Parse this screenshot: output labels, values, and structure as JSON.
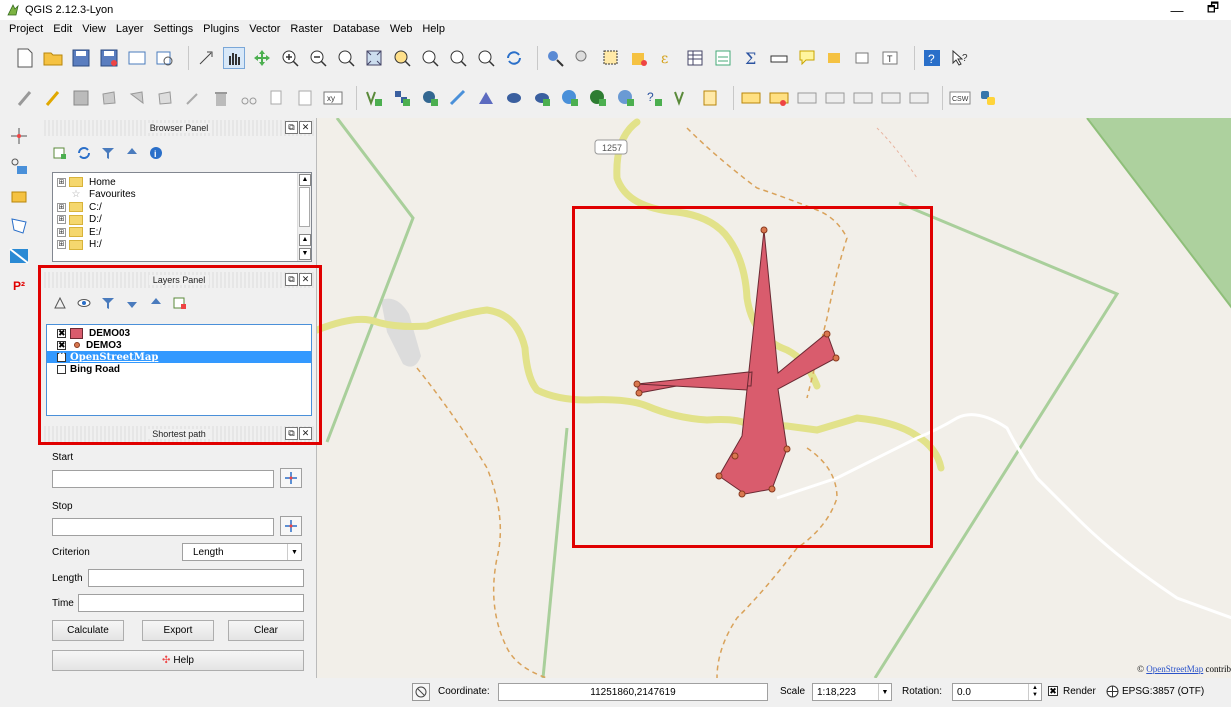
{
  "window": {
    "title": "QGIS 2.12.3-Lyon",
    "minimize": "—",
    "restore": "🗗"
  },
  "menu": [
    "Project",
    "Edit",
    "View",
    "Layer",
    "Settings",
    "Plugins",
    "Vector",
    "Raster",
    "Database",
    "Web",
    "Help"
  ],
  "browser_panel": {
    "title": "Browser Panel",
    "items": [
      {
        "label": "Home",
        "type": "folder",
        "expand": "⊞"
      },
      {
        "label": "Favourites",
        "type": "star",
        "expand": ""
      },
      {
        "label": "C:/",
        "type": "folder",
        "expand": "⊞"
      },
      {
        "label": "D:/",
        "type": "folder",
        "expand": "⊞"
      },
      {
        "label": "E:/",
        "type": "folder",
        "expand": "⊞"
      },
      {
        "label": "H:/",
        "type": "folder",
        "expand": "⊞"
      }
    ]
  },
  "layers_panel": {
    "title": "Layers Panel",
    "layers": [
      {
        "label": "DEMO03",
        "checked": "✖",
        "symbol": "polygon",
        "selected": false
      },
      {
        "label": "DEMO3",
        "checked": "✖",
        "symbol": "point",
        "selected": false
      },
      {
        "label": "OpenStreetMap",
        "checked": "✖",
        "symbol": "none",
        "selected": true
      },
      {
        "label": "Bing Road",
        "checked": "",
        "symbol": "none",
        "selected": false
      }
    ]
  },
  "shortest_path": {
    "title": "Shortest path",
    "start_label": "Start",
    "stop_label": "Stop",
    "criterion_label": "Criterion",
    "criterion_value": "Length",
    "length_label": "Length",
    "time_label": "Time",
    "calculate": "Calculate",
    "export": "Export",
    "clear": "Clear",
    "help": "Help"
  },
  "map": {
    "road_label": "1257",
    "attribution_prefix": "© ",
    "attribution_link": "OpenStreetMap",
    "attribution_suffix": " contrib",
    "highlight_color": "#e00000",
    "polygon_color": "#d95c6d"
  },
  "statusbar": {
    "coordinate_label": "Coordinate:",
    "coordinate_value": "11251860,2147619",
    "scale_label": "Scale",
    "scale_value": "1:18,223",
    "rotation_label": "Rotation:",
    "rotation_value": "0.0",
    "render_label": "Render",
    "render_checked": "✖",
    "crs": "EPSG:3857 (OTF)"
  },
  "left_strip_text": "P²"
}
